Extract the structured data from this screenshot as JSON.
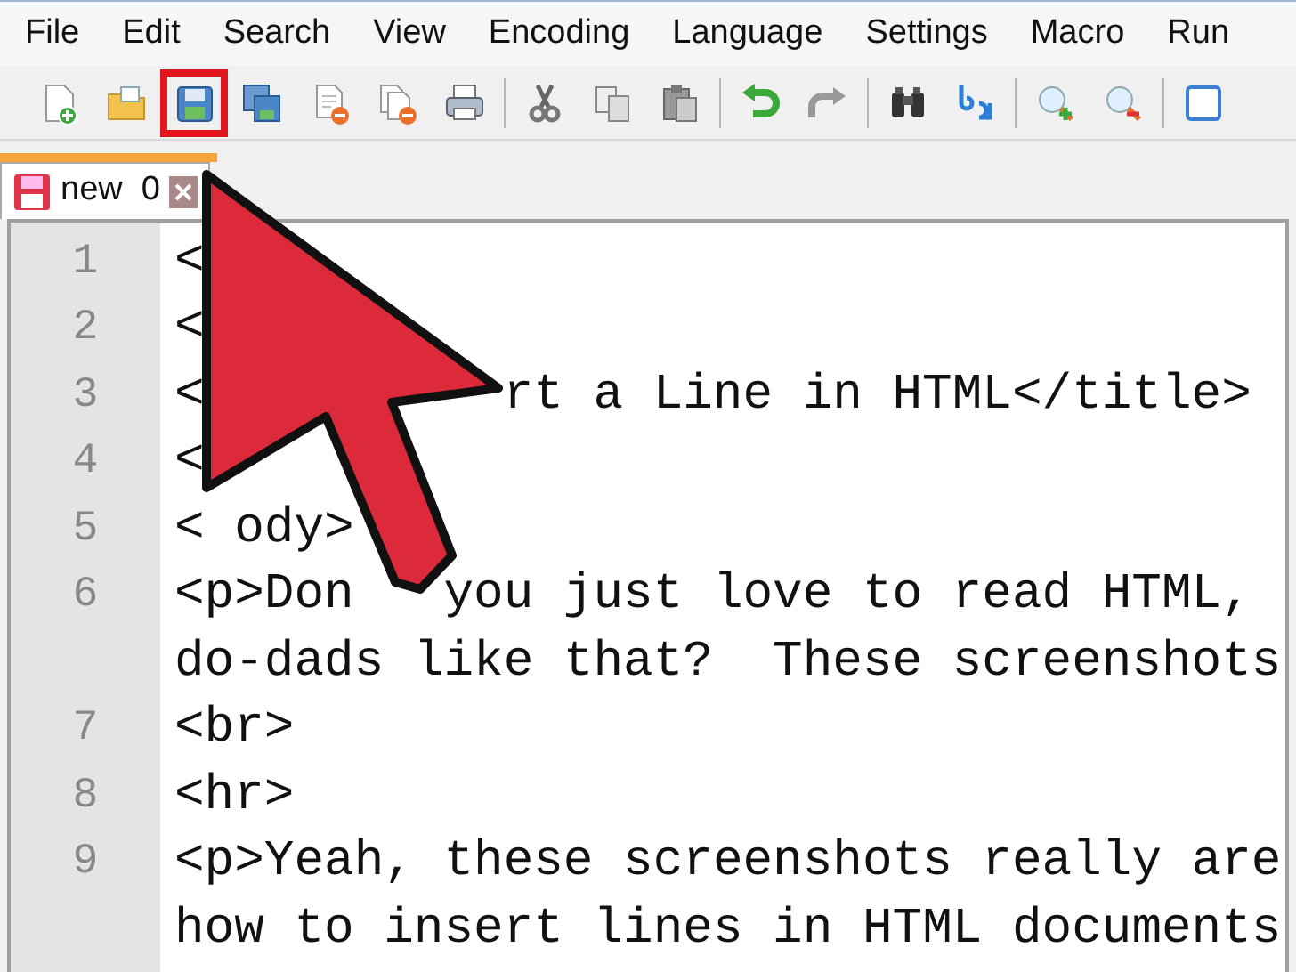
{
  "menu": [
    "File",
    "Edit",
    "Search",
    "View",
    "Encoding",
    "Language",
    "Settings",
    "Macro",
    "Run"
  ],
  "toolbar": [
    {
      "kind": "new"
    },
    {
      "kind": "open"
    },
    {
      "kind": "save",
      "highlighted": true
    },
    {
      "kind": "save_all"
    },
    {
      "kind": "close"
    },
    {
      "kind": "close_all"
    },
    {
      "kind": "print"
    },
    {
      "kind": "separator"
    },
    {
      "kind": "cut"
    },
    {
      "kind": "copy"
    },
    {
      "kind": "paste"
    },
    {
      "kind": "separator"
    },
    {
      "kind": "undo"
    },
    {
      "kind": "redo"
    },
    {
      "kind": "separator"
    },
    {
      "kind": "find"
    },
    {
      "kind": "replace"
    },
    {
      "kind": "separator"
    },
    {
      "kind": "zoom_in"
    },
    {
      "kind": "zoom_out"
    },
    {
      "kind": "separator"
    },
    {
      "kind": "window"
    }
  ],
  "tabs": [
    {
      "label": "new  0",
      "selected": true
    }
  ],
  "lines": [
    {
      "number": "1",
      "fragments": [
        "<"
      ]
    },
    {
      "number": "2",
      "fragments": [
        "<"
      ]
    },
    {
      "number": "3",
      "fragments": [
        "<",
        "rt a Line in HTML</title>"
      ]
    },
    {
      "number": "4",
      "fragments": [
        "<"
      ]
    },
    {
      "number": "5",
      "fragments": [
        "<",
        "ody>"
      ]
    },
    {
      "number": "6",
      "fragments": [
        "<p>Don",
        "you just love to read HTML,"
      ]
    },
    {
      "fragments": [
        "do-dads like that?  These screenshots"
      ]
    },
    {
      "number": "7",
      "fragments": [
        "<br>"
      ]
    },
    {
      "number": "8",
      "fragments": [
        "<hr>"
      ]
    },
    {
      "number": "9",
      "fragments": [
        "<p>Yeah, these screenshots really are"
      ]
    },
    {
      "fragments": [
        "how to insert lines in HTML documents"
      ]
    }
  ]
}
